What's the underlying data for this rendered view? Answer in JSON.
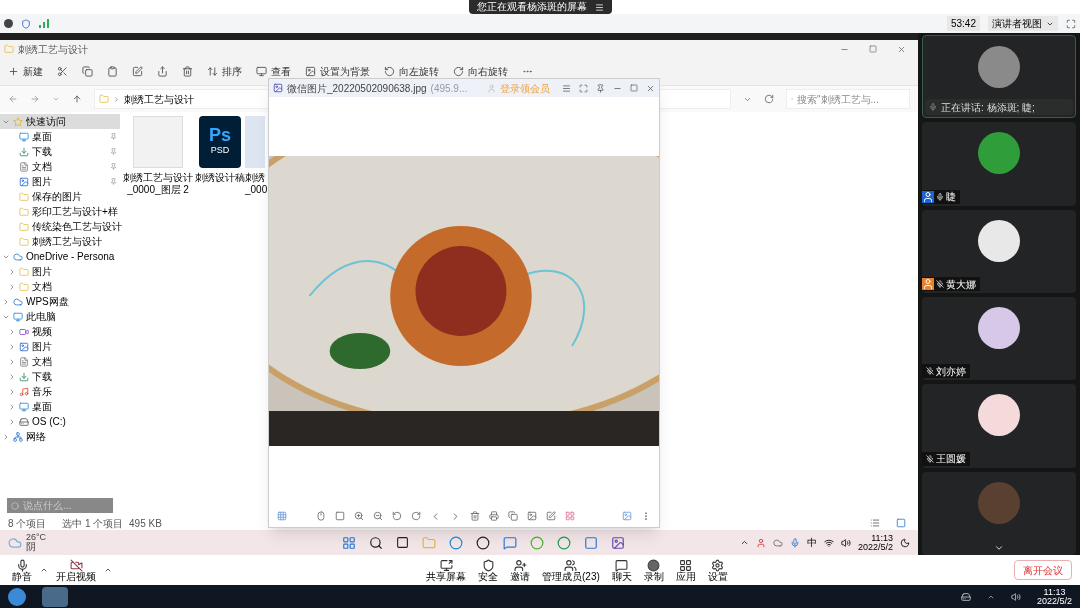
{
  "banner": {
    "text": "您正在观看杨添斑的屏幕"
  },
  "meeting_top": {
    "timer": "53:42",
    "view_button": "演讲者视图"
  },
  "explorer": {
    "title": "刺绣工艺与设计",
    "toolbar": [
      {
        "kind": "new",
        "label": "新建"
      },
      {
        "kind": "cut"
      },
      {
        "kind": "copy"
      },
      {
        "kind": "paste"
      },
      {
        "kind": "rename"
      },
      {
        "kind": "share"
      },
      {
        "kind": "delete"
      },
      {
        "kind": "sort",
        "label": "排序"
      },
      {
        "kind": "view",
        "label": "查看"
      },
      {
        "kind": "wallpaper",
        "label": "设置为背景"
      },
      {
        "kind": "rotate_left",
        "label": "向左旋转"
      },
      {
        "kind": "rotate_right",
        "label": "向右旋转"
      },
      {
        "kind": "more"
      }
    ],
    "path": "刺绣工艺与设计",
    "search": {
      "placeholder": "搜索\"刺绣工艺与..."
    },
    "sidebar": [
      {
        "label": "快速访问",
        "kind": "star",
        "expanded": true,
        "selected": true,
        "children": [
          {
            "label": "桌面",
            "kind": "desktop",
            "pinned": true,
            "selected": false
          },
          {
            "label": "下载",
            "kind": "download",
            "pinned": true,
            "selected": false
          },
          {
            "label": "文档",
            "kind": "document",
            "pinned": true,
            "selected": false
          },
          {
            "label": "图片",
            "kind": "picture",
            "pinned": true,
            "selected": false
          },
          {
            "label": "保存的图片",
            "kind": "folder",
            "pinned": false,
            "selected": false
          },
          {
            "label": "彩印工艺与设计+样",
            "kind": "folder",
            "pinned": false,
            "selected": false
          },
          {
            "label": "传统染色工艺与设计",
            "kind": "folder",
            "pinned": false,
            "selected": false
          },
          {
            "label": "刺绣工艺与设计",
            "kind": "folder",
            "pinned": false,
            "selected": false
          }
        ]
      },
      {
        "label": "OneDrive - Persona",
        "kind": "cloud",
        "expanded": true,
        "selected": false,
        "children": [
          {
            "label": "图片",
            "kind": "folder",
            "expanded": false,
            "selected": false
          },
          {
            "label": "文档",
            "kind": "folder",
            "expanded": false,
            "selected": false
          }
        ]
      },
      {
        "label": "WPS网盘",
        "kind": "cloud",
        "expanded": false,
        "selected": false
      },
      {
        "label": "此电脑",
        "kind": "computer",
        "expanded": true,
        "selected": false,
        "children": [
          {
            "label": "视频",
            "kind": "video",
            "expanded": false,
            "selected": false
          },
          {
            "label": "图片",
            "kind": "picture",
            "expanded": false,
            "selected": false
          },
          {
            "label": "文档",
            "kind": "document",
            "expanded": false,
            "selected": false
          },
          {
            "label": "下载",
            "kind": "download",
            "expanded": false,
            "selected": false
          },
          {
            "label": "音乐",
            "kind": "music",
            "expanded": false,
            "selected": false
          },
          {
            "label": "桌面",
            "kind": "desktop",
            "expanded": false,
            "selected": false
          },
          {
            "label": "OS (C:)",
            "kind": "drive",
            "expanded": false,
            "selected": false
          }
        ]
      },
      {
        "label": "网络",
        "kind": "network",
        "expanded": false,
        "selected": false
      }
    ],
    "files": [
      {
        "kind": "sketch",
        "lines": [
          "刺绣工艺与设计",
          "_0000_图层 2"
        ]
      },
      {
        "kind": "psd",
        "badge": "Ps",
        "ext": "PSD",
        "lines": [
          "刺绣设计稿"
        ]
      },
      {
        "kind": "image",
        "lines": [
          "刺绣",
          "_000"
        ]
      }
    ],
    "comment_field": {
      "placeholder": "说点什么..."
    },
    "status": [
      "8 个项目",
      "选中 1 个项目  495 KB"
    ]
  },
  "viewer": {
    "filename": "微信图片_20220502090638.jpg",
    "size": "(495.9...",
    "login": "登录领会员"
  },
  "win_taskbar": {
    "temperature": "26°C",
    "weather": "阴",
    "ime": "中",
    "time": "11:13",
    "date": "2022/5/2"
  },
  "participants": [
    {
      "name": "正在讲话: 杨添斑; 睫;",
      "kind": "speaker",
      "color": "#8a8a8a"
    },
    {
      "name": "睫",
      "kind": "host",
      "color": "#2f9e3a"
    },
    {
      "name": "黄大娜",
      "kind": "cohost",
      "color": "#e8e8e8"
    },
    {
      "name": "刘亦婷",
      "kind": "member",
      "color": "#d8c8e8"
    },
    {
      "name": "王圆媛",
      "kind": "member",
      "color": "#f4dada"
    },
    {
      "kind": "partial",
      "color": "#5a4030"
    }
  ],
  "meeting_toolbar": {
    "left": [
      {
        "kind": "mic",
        "label": "静音"
      },
      {
        "kind": "video",
        "label": "开启视频"
      }
    ],
    "center": [
      {
        "kind": "share",
        "label": "共享屏幕"
      },
      {
        "kind": "security",
        "label": "安全"
      },
      {
        "kind": "invite",
        "label": "邀请"
      },
      {
        "kind": "members",
        "label": "管理成员(23)"
      },
      {
        "kind": "chat",
        "label": "聊天"
      },
      {
        "kind": "record",
        "label": "录制"
      },
      {
        "kind": "apps",
        "label": "应用"
      },
      {
        "kind": "settings",
        "label": "设置"
      }
    ],
    "leave": "离开会议"
  },
  "os_taskbar": {
    "time": "11:13",
    "date": "2022/5/2"
  }
}
